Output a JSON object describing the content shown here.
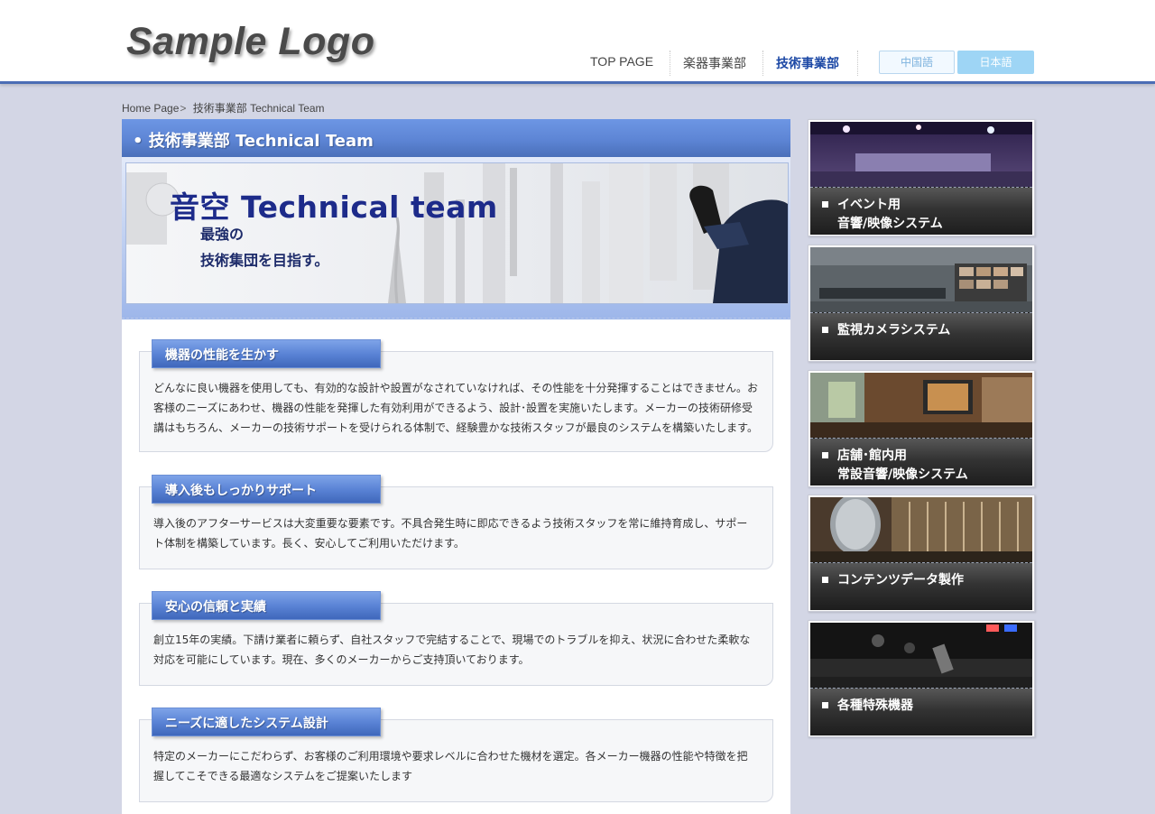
{
  "header": {
    "logo": "Sample Logo",
    "nav": [
      "TOP PAGE",
      "楽器事業部",
      "技術事業部"
    ],
    "lang_cn": "中国語",
    "lang_jp": "日本語"
  },
  "breadcrumb": {
    "home": "Home Page",
    "sep": ">",
    "current": "技術事業部 Technical Team"
  },
  "main": {
    "title": "• 技術事業部 Technical Team",
    "banner": {
      "title": "音空 Technical team",
      "sub1": "最強の",
      "sub2": "技術集団を目指す。"
    },
    "sections": [
      {
        "heading": "機器の性能を生かす",
        "text": "どんなに良い機器を使用しても、有効的な設計や設置がなされていなければ、その性能を十分発揮することはできません。お客様のニーズにあわせ、機器の性能を発揮した有効利用ができるよう、設計･設置を実施いたします。メーカーの技術研修受講はもちろん、メーカーの技術サポートを受けられる体制で、経験豊かな技術スタッフが最良のシステムを構築いたします。"
      },
      {
        "heading": "導入後もしっかりサポート",
        "text": "導入後のアフターサービスは大変重要な要素です。不具合発生時に即応できるよう技術スタッフを常に維持育成し、サポート体制を構築しています。長く、安心してご利用いただけます。"
      },
      {
        "heading": "安心の信頼と実績",
        "text": "創立15年の実績。下請け業者に頼らず、自社スタッフで完結することで、現場でのトラブルを抑え、状況に合わせた柔軟な対応を可能にしています。現在、多くのメーカーからご支持頂いております。"
      },
      {
        "heading": "ニーズに適したシステム設計",
        "text": "特定のメーカーにこだわらず、お客様のご利用環境や要求レベルに合わせた機材を選定。各メーカー機器の性能や特徴を把握してこそできる最適なシステムをご提案いたします"
      }
    ]
  },
  "sidebar": {
    "items": [
      {
        "line1": "イベント用",
        "line2": "音響/映像システム"
      },
      {
        "line1": "監視カメラシステム",
        "line2": ""
      },
      {
        "line1": "店舗･館内用",
        "line2": "常設音響/映像システム"
      },
      {
        "line1": "コンテンツデータ製作",
        "line2": ""
      },
      {
        "line1": "各種特殊機器",
        "line2": ""
      }
    ]
  }
}
